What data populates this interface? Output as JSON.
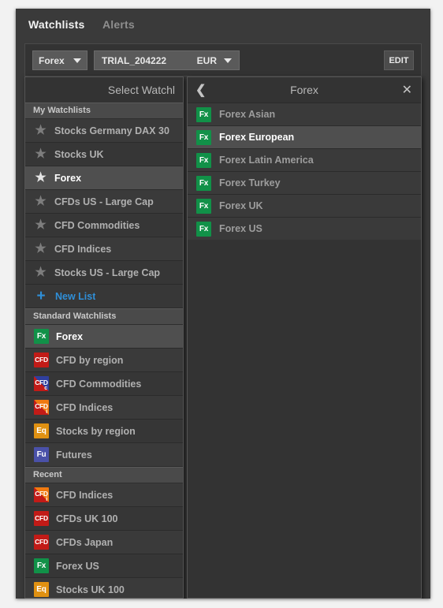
{
  "window": {
    "tabs": [
      {
        "label": "Watchlists",
        "active": true
      },
      {
        "label": "Alerts",
        "active": false
      }
    ]
  },
  "toolbar": {
    "symbol_select": {
      "value": "Forex",
      "icon": "chevron-down-icon"
    },
    "account_select": {
      "value": "TRIAL_204222",
      "currency": "EUR",
      "icon": "chevron-down-icon"
    },
    "edit_label": "EDIT"
  },
  "watchlist_panel": {
    "title": "Select Watchl",
    "sections": [
      {
        "header": "My Watchlists",
        "items": [
          {
            "label": "Stocks Germany DAX 30",
            "icon": "star-icon",
            "selected": false
          },
          {
            "label": "Stocks UK",
            "icon": "star-icon",
            "selected": false
          },
          {
            "label": "Forex",
            "icon": "star-icon",
            "selected": true
          },
          {
            "label": "CFDs US - Large Cap",
            "icon": "star-icon",
            "selected": false
          },
          {
            "label": "CFD Commodities",
            "icon": "star-icon",
            "selected": false
          },
          {
            "label": "CFD Indices",
            "icon": "star-icon",
            "selected": false
          },
          {
            "label": "Stocks US - Large Cap",
            "icon": "star-icon",
            "selected": false
          }
        ],
        "action": {
          "label": "New List",
          "icon": "plus-icon",
          "color": "#2f8fd8"
        }
      },
      {
        "header": "Standard Watchlists",
        "items": [
          {
            "label": "Forex",
            "icon": "fx-badge-icon",
            "badge": "Fx",
            "selected": true
          },
          {
            "label": "CFD by region",
            "icon": "cfd-badge-icon",
            "badge": "CFD",
            "selected": false
          },
          {
            "label": "CFD Commodities",
            "icon": "cfd-commodities-badge-icon",
            "badge": "CFD",
            "sub": "c",
            "selected": false
          },
          {
            "label": "CFD Indices",
            "icon": "cfd-indices-badge-icon",
            "badge": "CFD",
            "sub": "i",
            "selected": false
          },
          {
            "label": "Stocks by region",
            "icon": "eq-badge-icon",
            "badge": "Eq",
            "selected": false
          },
          {
            "label": "Futures",
            "icon": "fu-badge-icon",
            "badge": "Fu",
            "selected": false
          }
        ]
      },
      {
        "header": "Recent",
        "items": [
          {
            "label": "CFD Indices",
            "icon": "cfd-indices-badge-icon",
            "badge": "CFD",
            "sub": "i",
            "selected": false
          },
          {
            "label": "CFDs UK 100",
            "icon": "cfd-badge-icon",
            "badge": "CFD",
            "selected": false
          },
          {
            "label": "CFDs Japan",
            "icon": "cfd-badge-icon",
            "badge": "CFD",
            "selected": false
          },
          {
            "label": "Forex US",
            "icon": "fx-badge-icon",
            "badge": "Fx",
            "selected": false
          },
          {
            "label": "Stocks UK 100",
            "icon": "eq-badge-icon",
            "badge": "Eq",
            "selected": false
          }
        ]
      }
    ]
  },
  "detail_panel": {
    "title": "Forex",
    "back_icon": "chevron-left-icon",
    "close_icon": "close-icon",
    "items": [
      {
        "label": "Forex Asian",
        "badge": "Fx",
        "selected": false
      },
      {
        "label": "Forex European",
        "badge": "Fx",
        "selected": true
      },
      {
        "label": "Forex Latin America",
        "badge": "Fx",
        "selected": false
      },
      {
        "label": "Forex Turkey",
        "badge": "Fx",
        "selected": false
      },
      {
        "label": "Forex UK",
        "badge": "Fx",
        "selected": false
      },
      {
        "label": "Forex US",
        "badge": "Fx",
        "selected": false
      }
    ]
  },
  "colors": {
    "accent_blue": "#2f8fd8",
    "fx_green": "#119148",
    "cfd_red": "#c21b17",
    "eq_orange": "#e09112",
    "fu_blue": "#4a51a8",
    "indices_orange": "#f07a10",
    "commodities_blue": "#2f3f9e"
  }
}
